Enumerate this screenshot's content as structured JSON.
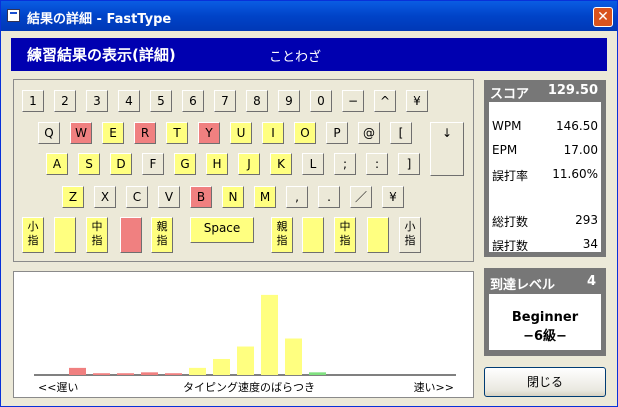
{
  "window": {
    "title": "結果の詳細 - FastType",
    "close_glyph": "✕"
  },
  "header": {
    "title": "練習結果の表示(詳細)",
    "subtitle": "ことわざ"
  },
  "colors": {
    "untyped": "#ECE9D8",
    "typed": "#FFFF80",
    "mistyped": "#F08080",
    "header_bg": "#0000B0",
    "panel_bg": "#777777"
  },
  "keyboard": {
    "row1": [
      {
        "label": "1",
        "state": "plain"
      },
      {
        "label": "2",
        "state": "plain"
      },
      {
        "label": "3",
        "state": "plain"
      },
      {
        "label": "4",
        "state": "plain"
      },
      {
        "label": "5",
        "state": "plain"
      },
      {
        "label": "6",
        "state": "plain"
      },
      {
        "label": "7",
        "state": "plain"
      },
      {
        "label": "8",
        "state": "plain"
      },
      {
        "label": "9",
        "state": "plain"
      },
      {
        "label": "0",
        "state": "plain"
      },
      {
        "label": "−",
        "state": "plain"
      },
      {
        "label": "^",
        "state": "plain"
      },
      {
        "label": "¥",
        "state": "plain"
      }
    ],
    "row2": [
      {
        "label": "Q",
        "state": "plain"
      },
      {
        "label": "W",
        "state": "miss"
      },
      {
        "label": "E",
        "state": "typed"
      },
      {
        "label": "R",
        "state": "miss"
      },
      {
        "label": "T",
        "state": "typed"
      },
      {
        "label": "Y",
        "state": "miss"
      },
      {
        "label": "U",
        "state": "typed"
      },
      {
        "label": "I",
        "state": "typed"
      },
      {
        "label": "O",
        "state": "typed"
      },
      {
        "label": "P",
        "state": "plain"
      },
      {
        "label": "@",
        "state": "plain"
      },
      {
        "label": "[",
        "state": "plain"
      }
    ],
    "row3": [
      {
        "label": "A",
        "state": "typed"
      },
      {
        "label": "S",
        "state": "typed"
      },
      {
        "label": "D",
        "state": "typed"
      },
      {
        "label": "F",
        "state": "plain"
      },
      {
        "label": "G",
        "state": "typed"
      },
      {
        "label": "H",
        "state": "typed"
      },
      {
        "label": "J",
        "state": "typed"
      },
      {
        "label": "K",
        "state": "typed"
      },
      {
        "label": "L",
        "state": "plain"
      },
      {
        "label": ";",
        "state": "plain"
      },
      {
        "label": ":",
        "state": "plain"
      },
      {
        "label": "]",
        "state": "plain"
      }
    ],
    "row4": [
      {
        "label": "Z",
        "state": "typed"
      },
      {
        "label": "X",
        "state": "plain"
      },
      {
        "label": "C",
        "state": "plain"
      },
      {
        "label": "V",
        "state": "plain"
      },
      {
        "label": "B",
        "state": "miss"
      },
      {
        "label": "N",
        "state": "typed"
      },
      {
        "label": "M",
        "state": "typed"
      },
      {
        "label": ",",
        "state": "plain"
      },
      {
        "label": ".",
        "state": "plain"
      },
      {
        "label": "／",
        "state": "plain"
      },
      {
        "label": "¥",
        "state": "plain"
      }
    ],
    "enter": {
      "label": "↓",
      "state": "plain"
    },
    "finger_row": [
      {
        "label": "小\n指",
        "state": "typed"
      },
      {
        "label": "",
        "state": "typed"
      },
      {
        "label": "中\n指",
        "state": "typed"
      },
      {
        "label": "",
        "state": "miss"
      },
      {
        "label": "親\n指",
        "state": "typed"
      },
      {
        "label": "Space",
        "state": "typed"
      },
      {
        "label": "親\n指",
        "state": "typed"
      },
      {
        "label": "",
        "state": "typed"
      },
      {
        "label": "中\n指",
        "state": "typed"
      },
      {
        "label": "",
        "state": "typed"
      },
      {
        "label": "小\n指",
        "state": "plain"
      }
    ]
  },
  "score": {
    "label": "スコア",
    "value": "129.50",
    "rows": [
      {
        "label": "WPM",
        "value": "146.50"
      },
      {
        "label": "EPM",
        "value": "17.00"
      },
      {
        "label": "誤打率",
        "value": "11.60%"
      },
      {
        "label": "総打数",
        "value": "293"
      },
      {
        "label": "誤打数",
        "value": "34"
      }
    ]
  },
  "level": {
    "label": "到達レベル",
    "value": "4",
    "rank": "Beginner",
    "grade": "−6級−"
  },
  "close_button": {
    "label": "閉じる"
  },
  "chart_data": {
    "type": "bar",
    "title": "",
    "xlabel": "タイピング速度のばらつき",
    "left_label": "<<遅い",
    "right_label": "速い>>",
    "ylabel": "",
    "bars": [
      {
        "value": 0.8,
        "color": "#F08080"
      },
      {
        "value": 0.2,
        "color": "#F08080"
      },
      {
        "value": 0.2,
        "color": "#F08080"
      },
      {
        "value": 0.3,
        "color": "#F08080"
      },
      {
        "value": 0.2,
        "color": "#F08080"
      },
      {
        "value": 0.8,
        "color": "#FFFF80"
      },
      {
        "value": 1.8,
        "color": "#FFFF80"
      },
      {
        "value": 3.2,
        "color": "#FFFF80"
      },
      {
        "value": 9.0,
        "color": "#FFFF80"
      },
      {
        "value": 4.1,
        "color": "#FFFF80"
      },
      {
        "value": 0.3,
        "color": "#80E080"
      }
    ],
    "ylim": [
      0,
      10
    ]
  }
}
